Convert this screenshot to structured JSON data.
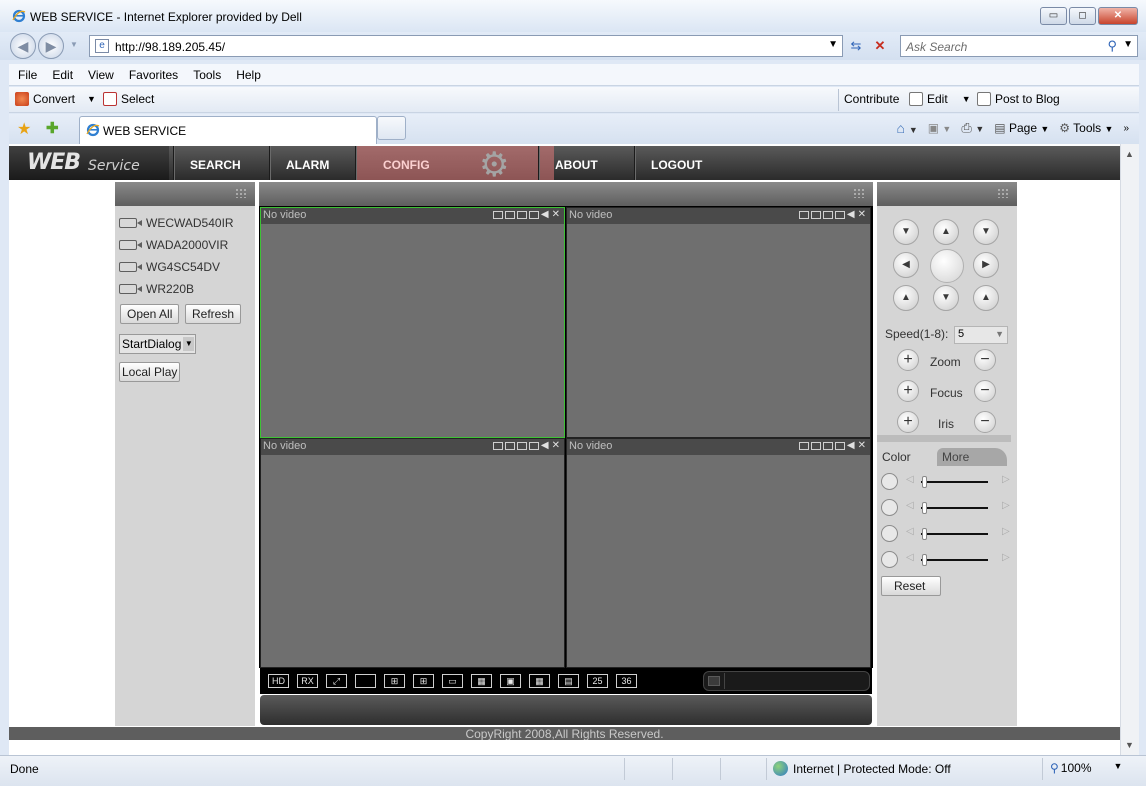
{
  "browser": {
    "window_title": "WEB SERVICE - Internet Explorer provided by Dell",
    "url": "http://98.189.205.45/",
    "search_placeholder": "Ask Search",
    "menu": [
      "File",
      "Edit",
      "View",
      "Favorites",
      "Tools",
      "Help"
    ],
    "linkbar": {
      "convert": "Convert",
      "select": "Select",
      "contribute": "Contribute",
      "edit": "Edit",
      "post_to_blog": "Post to Blog"
    },
    "tab_title": "WEB SERVICE",
    "commandbar": {
      "page": "Page",
      "tools": "Tools"
    },
    "status": {
      "done": "Done",
      "zone": "Internet | Protected Mode: Off",
      "zoom": "100%"
    }
  },
  "app": {
    "logo_main": "WEB",
    "logo_sub": "Service",
    "nav": [
      "SEARCH",
      "ALARM",
      "CONFIG",
      "ABOUT",
      "LOGOUT"
    ],
    "devices": [
      "WECWAD540IR",
      "WADA2000VIR",
      "WG4SC54DV",
      "WR220B"
    ],
    "buttons": {
      "open_all": "Open All",
      "refresh": "Refresh",
      "start_dialog": "StartDialog",
      "local_play": "Local Play"
    },
    "video_cells": [
      {
        "label": "No video",
        "active": true
      },
      {
        "label": "No video",
        "active": false
      },
      {
        "label": "No video",
        "active": false
      },
      {
        "label": "No video",
        "active": false
      }
    ],
    "layout_buttons": [
      "HD",
      "RX",
      "",
      "",
      "",
      "",
      "",
      "",
      "",
      "",
      "",
      "25",
      "36"
    ],
    "ptz": {
      "speed_label": "Speed(1-8):",
      "speed_value": "5",
      "zoom": "Zoom",
      "focus": "Focus",
      "iris": "Iris"
    },
    "color_tabs": {
      "color": "Color",
      "more": "More"
    },
    "reset": "Reset",
    "copyright": "CopyRight 2008,All Rights Reserved."
  }
}
